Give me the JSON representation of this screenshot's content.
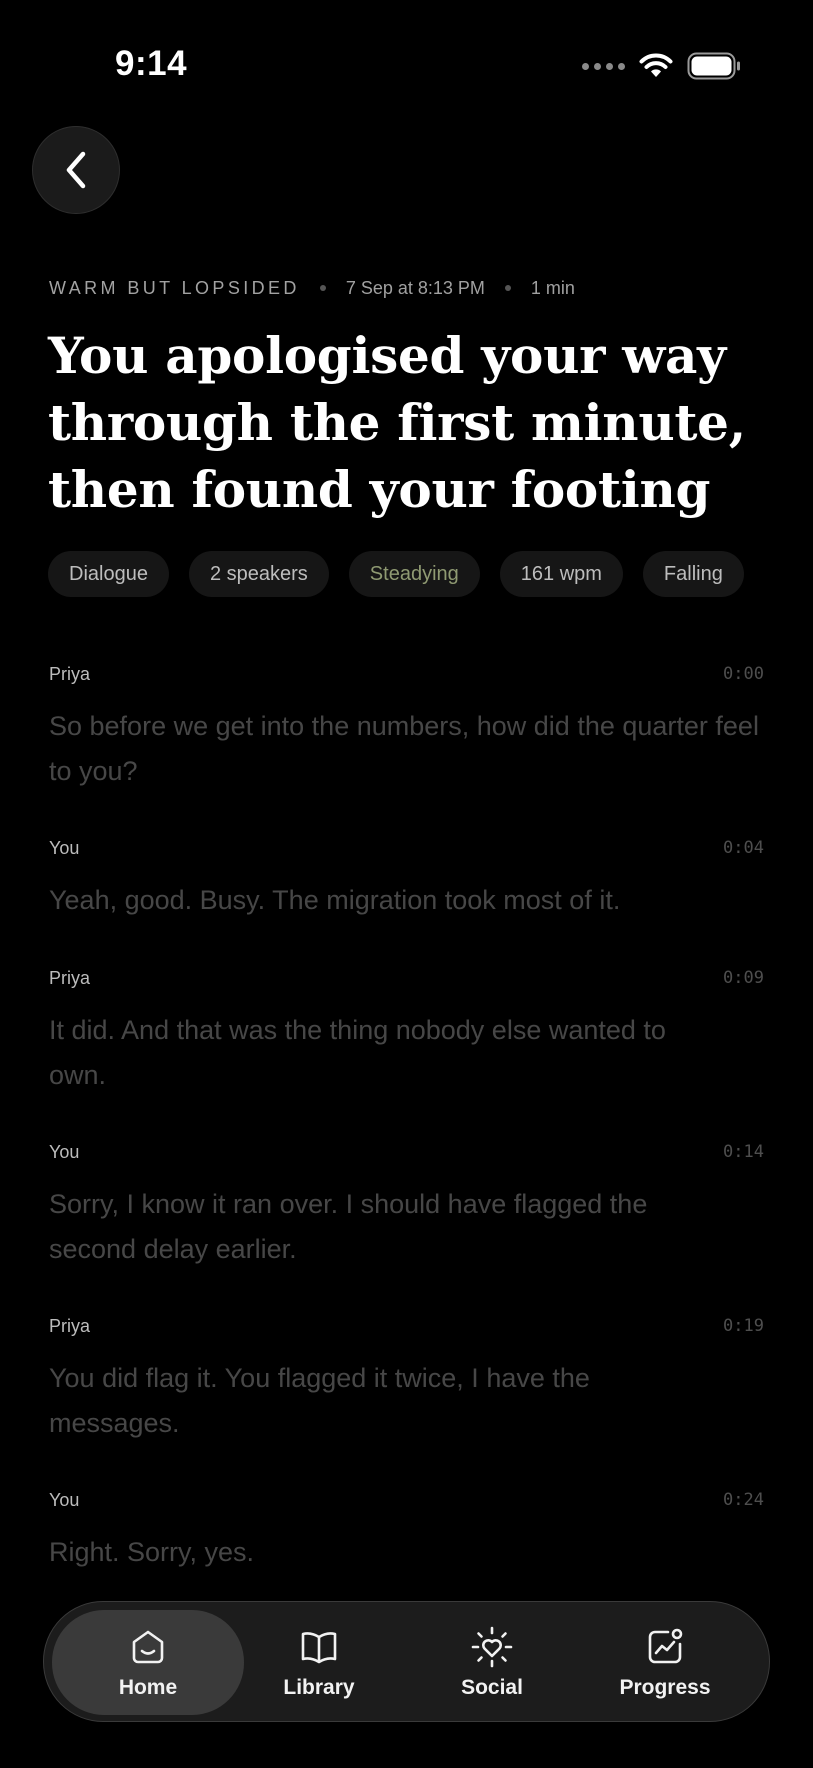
{
  "status_bar": {
    "time": "9:14"
  },
  "header": {
    "back_icon": "chevron-left-icon",
    "mood": "WARM BUT LOPSIDED",
    "date": "7 Sep at 8:13 PM",
    "duration": "1 min",
    "title": "You apologised your way through the first minute, then found your footing"
  },
  "chips": [
    {
      "label": "Dialogue"
    },
    {
      "label": "2 speakers"
    },
    {
      "label": "Steadying",
      "accent": "#8f9a72"
    },
    {
      "label": "161 wpm"
    },
    {
      "label": "Falling"
    }
  ],
  "transcript": [
    {
      "speaker": "Priya",
      "time": "0:00",
      "text": "So before we get into the numbers, how did the quarter feel to you?"
    },
    {
      "speaker": "You",
      "time": "0:04",
      "text": "Yeah, good. Busy. The migration took most of it."
    },
    {
      "speaker": "Priya",
      "time": "0:09",
      "text": "It did. And that was the thing nobody else wanted to own."
    },
    {
      "speaker": "You",
      "time": "0:14",
      "text": "Sorry, I know it ran over. I should have flagged the second delay earlier."
    },
    {
      "speaker": "Priya",
      "time": "0:19",
      "text": "You did flag it. You flagged it twice, I have the messages."
    },
    {
      "speaker": "You",
      "time": "0:24",
      "text": "Right. Sorry, yes."
    }
  ],
  "tab_bar": {
    "tabs": [
      {
        "label": "Home",
        "icon": "home-smile-icon",
        "active": true
      },
      {
        "label": "Library",
        "icon": "book-icon",
        "active": false
      },
      {
        "label": "Social",
        "icon": "heart-sun-icon",
        "active": false
      },
      {
        "label": "Progress",
        "icon": "progress-chart-icon",
        "active": false
      }
    ]
  }
}
